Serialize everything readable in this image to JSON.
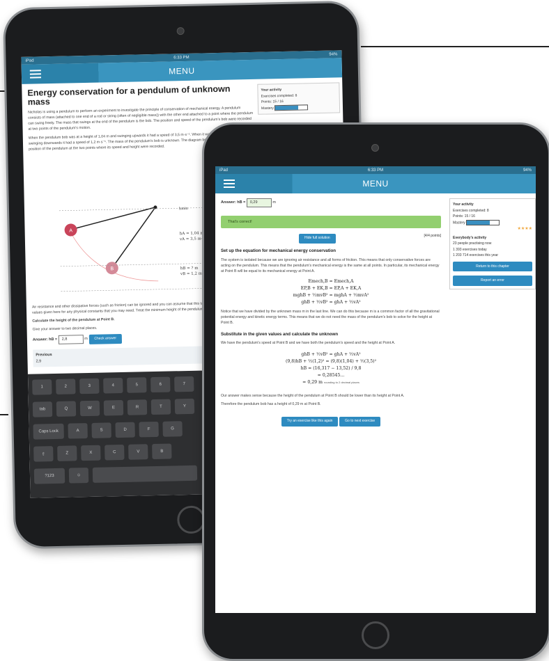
{
  "back": {
    "status_time": "6:33 PM",
    "status_left": "iPad",
    "status_right": "94%",
    "menu_label": "MENU",
    "title": "Energy conservation for a pendulum of unknown mass",
    "intro": "Nicholas is using a pendulum to perform an experiment to investigate the principle of conservation of mechanical energy. A pendulum consists of mass (attached to one end of a rod or string (often of negligible mass)) with the other end attached to a point where the pendulum can swing freely. The mass that swings at the end of the pendulum is the bob. The position and speed of the pendulum's bob were recorded at two points of the pendulum's motion.",
    "intro2": "When the pendulum bob was at a height of 1,04 m and swinging upwards it had a speed of 3,5 m·s⁻¹. When it was at a height of hB and swinging downwards it had a speed of 1,2 m·s⁻¹. The mass of the pendulum's bob is unknown. The diagram below (not to scale) shows the position of the pendulum at the two points where its speed and height were recorded.",
    "labels": {
      "hA": "hA = 1,04 m",
      "vA": "vA = 3,5 m·s⁻¹",
      "hB": "hB = ? m",
      "vB": "vB = 1,2 m·s⁻¹",
      "ref": "hmin"
    },
    "para3": "Air resistance and other dissipative forces (such as friction) can be ignored and you can assume that this takes place on Earth. Use the values given here for any physical constants that you may need. Treat the minimum height of the pendulum's swing as the zero of height.",
    "question": "Calculate the height of the pendulum at Point B.",
    "round": "Give your answer to two decimal places.",
    "answer_label": "Answer: hB =",
    "answer_value": "2,8",
    "answer_unit": "m",
    "check_btn": "Check answer",
    "prev_label": "Previous",
    "prev_value": "2,9",
    "side": {
      "title": "Your activity",
      "ex": "Exercises completed: 8",
      "points": "Points: 15 / 16",
      "mastery": "Mastery"
    },
    "keyboard": {
      "row1": [
        "1",
        "2",
        "3",
        "4",
        "5",
        "6",
        "7"
      ],
      "row2": [
        "tab",
        "Q",
        "W",
        "E",
        "R",
        "T",
        "Y"
      ],
      "row3": [
        "Caps Lock",
        "A",
        "S",
        "D",
        "F",
        "G"
      ],
      "row4": [
        "⇧",
        "Z",
        "X",
        "C",
        "V",
        "B"
      ],
      "row5": [
        "?123",
        "☺",
        ""
      ]
    }
  },
  "front": {
    "status_time": "6:33 PM",
    "status_left": "iPad",
    "status_right": "94%",
    "menu_label": "MENU",
    "answer_label": "Answer: hB =",
    "answer_value": "0,29",
    "answer_unit": "m",
    "correct_msg": "That's correct!",
    "hide_btn": "Hide full solution",
    "points": "[4/4 points]",
    "h_setup": "Set up the equation for mechanical energy conservation",
    "setup_text": "The system is isolated because we are ignoring air resistance and all forms of friction. This means that only conservative forces are acting on the pendulum. This means that the pendulum's mechanical energy is the same at all points. In particular, its mechanical energy at Point B will be equal to its mechanical energy at Point A.",
    "eq1": "Emech,B = Emech,A",
    "eq2": "EP,B + EK,B = EP,A + EK,A",
    "eq3": "mghB + ½mvB² = mghA + ½mvA²",
    "eq4": "ghB + ½vB² = ghA + ½vA²",
    "note_text": "Notice that we have divided by the unknown mass m in the last line. We can do this because m is a common factor of all the gravitational potential energy and kinetic energy terms. This means that we do not need the mass of the pendulum's bob to solve for the height at Point B.",
    "h_sub": "Substitute in the given values and calculate the unknown",
    "sub_text": "We have the pendulum's speed at Point B and we have both the pendulum's speed and the height at Point A.",
    "eq5": "ghB + ½vB² = ghA + ½vA²",
    "eq6": "(9,8)hB + ½(1,2)² = (9,8)(1,04) + ½(3,5)²",
    "eq7": "hB = (16,317 − 13,52) / 9,8",
    "eq8": "= 0,28545...",
    "eq9": "= 0,29 m",
    "eq_note": "rounding to 2 decimal places",
    "conclusion": "Our answer makes sense because the height of the pendulum at Point B should be lower than its height at Point A.",
    "final": "Therefore the pendulum bob has a height of 0,29 m at Point B.",
    "btn_similar": "Try an exercise like this again",
    "btn_next": "Go to next exercise",
    "side": {
      "title": "Your activity",
      "ex": "Exercises completed: 8",
      "points": "Points: 15 / 16",
      "mastery": "Mastery",
      "community": "Everybody's activity",
      "c1": "23 people practising now",
      "c2": "1 393 exercises today",
      "c3": "1 203 714 exercises this year",
      "btn1": "Return to this chapter",
      "btn2": "Report an error"
    }
  }
}
